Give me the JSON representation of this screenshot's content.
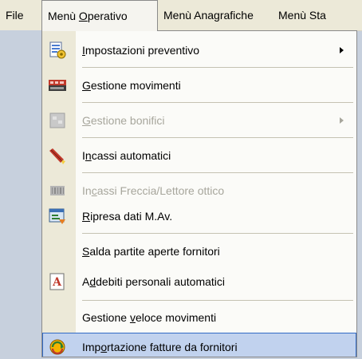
{
  "menubar": {
    "items": [
      "File",
      "Menù Operativo",
      "Menù Anagrafiche",
      "Menù Sta"
    ]
  },
  "menu": {
    "items": [
      {
        "pre": "",
        "key": "I",
        "post": "mpostazioni preventivo",
        "icon": "settings-sheet-icon",
        "submenu": true,
        "disabled": false
      },
      {
        "pre": "",
        "key": "G",
        "post": "estione movimenti",
        "icon": "movements-icon",
        "submenu": false,
        "disabled": false
      },
      {
        "pre": "",
        "key": "G",
        "post": "estione bonifici",
        "icon": "transfers-icon",
        "submenu": true,
        "disabled": true
      },
      {
        "pre": "I",
        "key": "n",
        "post": "cassi automatici",
        "icon": "scanner-icon",
        "submenu": false,
        "disabled": false
      },
      {
        "pre": "In",
        "key": "c",
        "post": "assi Freccia/Lettore ottico",
        "icon": "barcode-reader-icon",
        "submenu": false,
        "disabled": true
      },
      {
        "pre": "",
        "key": "R",
        "post": "ipresa dati M.Av.",
        "icon": "data-recovery-icon",
        "submenu": false,
        "disabled": false
      },
      {
        "pre": "",
        "key": "S",
        "post": "alda partite aperte fornitori",
        "icon": "",
        "submenu": false,
        "disabled": false
      },
      {
        "pre": "A",
        "key": "d",
        "post": "debiti personali automatici",
        "icon": "auto-debit-icon",
        "submenu": false,
        "disabled": false
      },
      {
        "pre": "Gestione ",
        "key": "v",
        "post": "eloce movimenti",
        "icon": "",
        "submenu": false,
        "disabled": false
      },
      {
        "pre": "Imp",
        "key": "o",
        "post": "rtazione fatture da fornitori",
        "icon": "import-invoices-icon",
        "submenu": false,
        "disabled": false
      }
    ]
  },
  "colors": {
    "menubar_bg": "#ece9d8",
    "desktop_bg": "#c7d0dd",
    "highlight_bg": "#c1d2ee",
    "highlight_border": "#316ac5",
    "disabled_text": "#a7a69c"
  }
}
